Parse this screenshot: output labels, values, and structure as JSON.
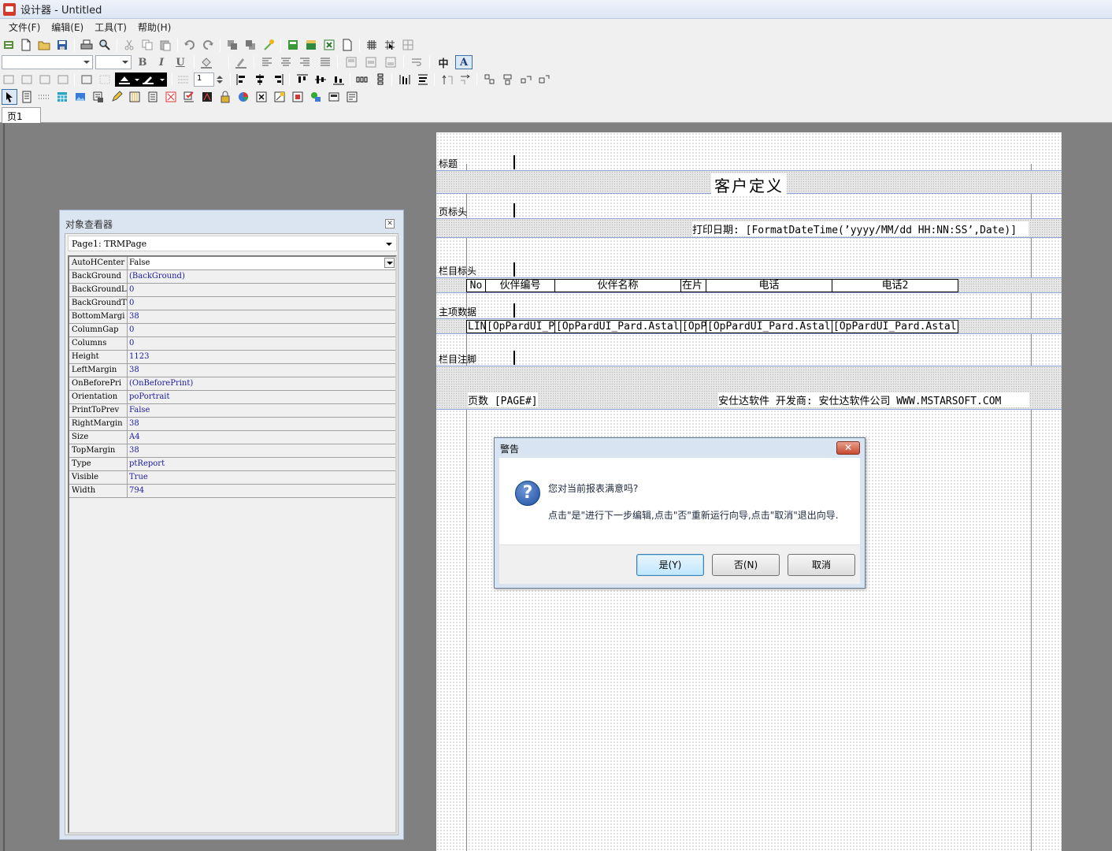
{
  "window": {
    "title": "设计器 - Untitled"
  },
  "menu": [
    "文件(F)",
    "编辑(E)",
    "工具(T)",
    "帮助(H)"
  ],
  "toolbar": {
    "font_size_value": "",
    "spin_value": "1",
    "char_button": "中",
    "bold": "B",
    "italic": "I",
    "underline": "U"
  },
  "tabs": {
    "page1": "页1"
  },
  "inspector": {
    "title": "对象查看器",
    "object": "Page1: TRMPage",
    "properties": [
      {
        "name": "AutoHCenter",
        "value": "False"
      },
      {
        "name": "BackGround",
        "value": "(BackGround)"
      },
      {
        "name": "BackGroundL",
        "value": "0"
      },
      {
        "name": "BackGroundT",
        "value": "0"
      },
      {
        "name": "BottomMargi",
        "value": "38"
      },
      {
        "name": "ColumnGap",
        "value": "0"
      },
      {
        "name": "Columns",
        "value": "0"
      },
      {
        "name": "Height",
        "value": "1123"
      },
      {
        "name": "LeftMargin",
        "value": "38"
      },
      {
        "name": "OnBeforePri",
        "value": "(OnBeforePrint)"
      },
      {
        "name": "Orientation",
        "value": "poPortrait"
      },
      {
        "name": "PrintToPrev",
        "value": "False"
      },
      {
        "name": "RightMargin",
        "value": "38"
      },
      {
        "name": "Size",
        "value": "A4"
      },
      {
        "name": "TopMargin",
        "value": "38"
      },
      {
        "name": "Type",
        "value": "ptReport"
      },
      {
        "name": "Visible",
        "value": "True"
      },
      {
        "name": "Width",
        "value": "794"
      }
    ]
  },
  "report": {
    "bands": {
      "title": "标题",
      "page_header": "页标头",
      "column_header": "栏目标头",
      "master_data": "主项数据",
      "column_footer": "栏目注脚"
    },
    "report_title": "客户定义",
    "print_date": "打印日期: [FormatDateTime(’yyyy/MM/dd HH:NN:SS’,Date)]",
    "columns": [
      "No",
      "伙伴编号",
      "伙伴名称",
      "在片",
      "电话",
      "电话2"
    ],
    "data_fields": [
      "LINE",
      "[OpPardUI_P",
      "[OpPardUI_Pard.Astal",
      "[OpP",
      "[OpPardUI_Pard.Astal",
      "[OpPardUI_Pard.Astal"
    ],
    "page_number": "页数 [PAGE#]",
    "footer_company": "安仕达软件 开发商: 安仕达软件公司 WWW.MSTARSOFT.COM"
  },
  "dialog": {
    "title": "警告",
    "message": "您对当前报表满意吗?",
    "detail": "点击\"是\"进行下一步编辑,点击\"否\"重新运行向导,点击\"取消\"退出向导.",
    "yes": "是(Y)",
    "no": "否(N)",
    "cancel": "取消",
    "close": "✕"
  }
}
